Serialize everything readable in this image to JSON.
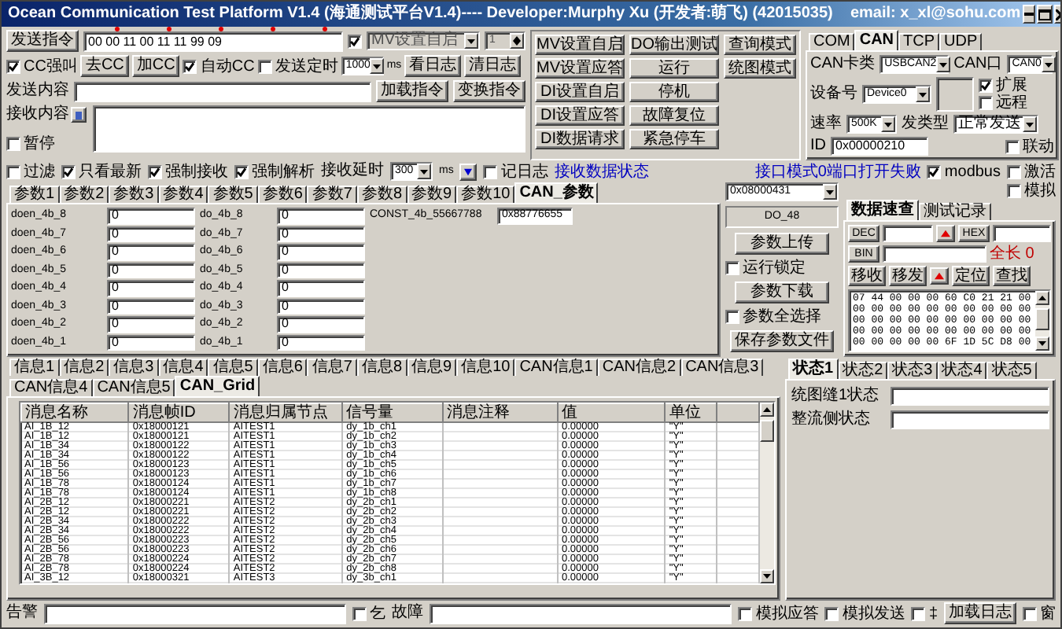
{
  "window": {
    "title": "Ocean Communication Test Platform V1.4 (海通测试平台V1.4)---- Developer:Murphy Xu (开发者:萌飞) (42015035)    email: x_xl@sohu.com"
  },
  "send_row": {
    "button": "发送指令",
    "value": "00 00 11 00 11 11 99 09",
    "enable_checked": true,
    "mode": {
      "value": "MV设置自启",
      "disabled": true
    },
    "spinner": {
      "value": "1",
      "disabled": true
    }
  },
  "command_row": [
    {
      "kind": "checkbox",
      "label": "CC强叫",
      "checked": true
    },
    {
      "kind": "button",
      "label": "去CC"
    },
    {
      "kind": "button",
      "label": "加CC"
    },
    {
      "kind": "checkbox",
      "label": "自动CC",
      "checked": true
    },
    {
      "kind": "checkbox",
      "label": "发送定时",
      "checked": false
    },
    {
      "kind": "combo",
      "value": "1000"
    },
    {
      "kind": "unit",
      "label": "ms"
    },
    {
      "kind": "button",
      "label": "看日志"
    },
    {
      "kind": "button",
      "label": "清日志"
    }
  ],
  "content_row": {
    "label": "发送内容",
    "buttons": [
      "加载指令",
      "变换指令"
    ]
  },
  "receive": {
    "label": "接收内容",
    "pause": {
      "label": "暂停",
      "checked": false
    }
  },
  "action_buttons": [
    [
      "MV设置自启",
      "MV设置应答",
      "DI设置自启",
      "DI设置应答",
      "DI数据请求"
    ],
    [
      "DO输出测试",
      "运行",
      "停机",
      "故障复位",
      "紧急停车"
    ],
    [
      "查询模式",
      "统图模式"
    ]
  ],
  "can_panel": {
    "tabs": [
      {
        "label": "COM",
        "selected": false
      },
      {
        "label": "CAN",
        "selected": true
      },
      {
        "label": "TCP",
        "selected": false
      },
      {
        "label": "UDP",
        "selected": false
      }
    ],
    "card_type": {
      "label": "CAN卡类",
      "value": "USBCAN2"
    },
    "port": {
      "label": "CAN口",
      "value": "CAN0"
    },
    "device": {
      "label": "设备号",
      "value": "Device0"
    },
    "extended": {
      "label": "扩展",
      "checked": true
    },
    "remote": {
      "label": "远程",
      "checked": false
    },
    "rate": {
      "label": "速率",
      "value": "500K"
    },
    "send_type": {
      "label": "发类型",
      "value": "正常发送"
    },
    "id": {
      "label": "ID",
      "value": "0x00000210"
    },
    "linkage": {
      "label": "联动",
      "checked": false
    }
  },
  "options": [
    {
      "kind": "checkbox",
      "label": "过滤",
      "checked": false
    },
    {
      "kind": "checkbox",
      "label": "只看最新",
      "checked": true
    },
    {
      "kind": "checkbox",
      "label": "强制接收",
      "checked": true
    },
    {
      "kind": "checkbox",
      "label": "强制解析",
      "checked": true
    },
    {
      "kind": "label",
      "label": "接收延时"
    },
    {
      "kind": "combo",
      "value": "300"
    },
    {
      "kind": "unit",
      "label": "ms"
    },
    {
      "kind": "icon_button"
    },
    {
      "kind": "checkbox",
      "label": "记日志",
      "checked": false
    },
    {
      "kind": "link",
      "label": "接收数据状态"
    }
  ],
  "status_message": "接口模式0端口打开失败",
  "flags": [
    {
      "label": "modbus",
      "checked": true
    },
    {
      "label": "激活",
      "checked": false
    }
  ],
  "simulate": {
    "label": "模拟",
    "checked": false
  },
  "params": {
    "tabs": [
      {
        "label": "参数1",
        "selected": false
      },
      {
        "label": "参数2",
        "selected": false
      },
      {
        "label": "参数3",
        "selected": false
      },
      {
        "label": "参数4",
        "selected": false
      },
      {
        "label": "参数5",
        "selected": false
      },
      {
        "label": "参数6",
        "selected": false
      },
      {
        "label": "参数7",
        "selected": false
      },
      {
        "label": "参数8",
        "selected": false
      },
      {
        "label": "参数9",
        "selected": false
      },
      {
        "label": "参数10",
        "selected": false
      },
      {
        "label": "CAN_参数",
        "selected": true
      }
    ],
    "left": [
      {
        "label": "doen_4b_8",
        "value": "0"
      },
      {
        "label": "doen_4b_7",
        "value": "0"
      },
      {
        "label": "doen_4b_6",
        "value": "0"
      },
      {
        "label": "doen_4b_5",
        "value": "0"
      },
      {
        "label": "doen_4b_4",
        "value": "0"
      },
      {
        "label": "doen_4b_3",
        "value": "0"
      },
      {
        "label": "doen_4b_2",
        "value": "0"
      },
      {
        "label": "doen_4b_1",
        "value": "0"
      }
    ],
    "right": [
      {
        "label": "do_4b_8",
        "value": "0"
      },
      {
        "label": "do_4b_7",
        "value": "0"
      },
      {
        "label": "do_4b_6",
        "value": "0"
      },
      {
        "label": "do_4b_5",
        "value": "0"
      },
      {
        "label": "do_4b_4",
        "value": "0"
      },
      {
        "label": "do_4b_3",
        "value": "0"
      },
      {
        "label": "do_4b_2",
        "value": "0"
      },
      {
        "label": "do_4b_1",
        "value": "0"
      }
    ],
    "const": {
      "label": "CONST_4b_55667788",
      "value": "0x88776655"
    }
  },
  "side": {
    "combo": "0x08000431",
    "caption": "DO_48",
    "upload": "参数上传",
    "lock": {
      "label": "运行锁定",
      "checked": false
    },
    "download": "参数下载",
    "select_all": {
      "label": "参数全选择",
      "checked": false
    },
    "save": "保存参数文件"
  },
  "data_panel": {
    "tabs": [
      {
        "label": "数据速查",
        "selected": true
      },
      {
        "label": "测试记录",
        "selected": false
      }
    ],
    "dec": "DEC",
    "hex": "HEX",
    "bin": "BIN",
    "length": "全长 0",
    "tools": [
      {
        "kind": "button",
        "label": "移收"
      },
      {
        "kind": "button",
        "label": "移发"
      },
      {
        "kind": "arrow"
      },
      {
        "kind": "button",
        "label": "定位"
      },
      {
        "kind": "button",
        "label": "查找"
      }
    ],
    "hex_lines": [
      "07 44 00 00 00 60 C0 21 21 00",
      "00 00 00 00 00 00 00 00 00 00",
      "00 00 00 00 00 00 00 00 00 00",
      "00 00 00 00 00 00 00 00 00 00",
      "00 00 00 00 00 6F 1D 5C D8 00"
    ]
  },
  "messages": {
    "tabs": [
      {
        "label": "信息1",
        "selected": false
      },
      {
        "label": "信息2",
        "selected": false
      },
      {
        "label": "信息3",
        "selected": false
      },
      {
        "label": "信息4",
        "selected": false
      },
      {
        "label": "信息5",
        "selected": false
      },
      {
        "label": "信息6",
        "selected": false
      },
      {
        "label": "信息7",
        "selected": false
      },
      {
        "label": "信息8",
        "selected": false
      },
      {
        "label": "信息9",
        "selected": false
      },
      {
        "label": "信息10",
        "selected": false
      },
      {
        "label": "CAN信息1",
        "selected": false
      },
      {
        "label": "CAN信息2",
        "selected": false
      },
      {
        "label": "CAN信息3",
        "selected": false
      },
      {
        "label": "CAN信息4",
        "selected": false
      },
      {
        "label": "CAN信息5",
        "selected": false
      },
      {
        "label": "CAN_Grid",
        "selected": true
      }
    ],
    "columns": [
      "消息名称",
      "消息帧ID",
      "消息归属节点",
      "信号量",
      "消息注释",
      "值",
      "单位"
    ],
    "rows": [
      {
        "name": "AI_1B_12",
        "frame_id": "0x18000121",
        "node": "AITEST1",
        "signal": "dy_1b_ch1",
        "value": "0.00000",
        "unit": "\"Y\""
      },
      {
        "name": "AI_1B_12",
        "frame_id": "0x18000121",
        "node": "AITEST1",
        "signal": "dy_1b_ch2",
        "value": "0.00000",
        "unit": "\"Y\""
      },
      {
        "name": "AI_1B_34",
        "frame_id": "0x18000122",
        "node": "AITEST1",
        "signal": "dy_1b_ch3",
        "value": "0.00000",
        "unit": "\"Y\""
      },
      {
        "name": "AI_1B_34",
        "frame_id": "0x18000122",
        "node": "AITEST1",
        "signal": "dy_1b_ch4",
        "value": "0.00000",
        "unit": "\"Y\""
      },
      {
        "name": "AI_1B_56",
        "frame_id": "0x18000123",
        "node": "AITEST1",
        "signal": "dy_1b_ch5",
        "value": "0.00000",
        "unit": "\"Y\""
      },
      {
        "name": "AI_1B_56",
        "frame_id": "0x18000123",
        "node": "AITEST1",
        "signal": "dy_1b_ch6",
        "value": "0.00000",
        "unit": "\"Y\""
      },
      {
        "name": "AI_1B_78",
        "frame_id": "0x18000124",
        "node": "AITEST1",
        "signal": "dy_1b_ch7",
        "value": "0.00000",
        "unit": "\"Y\""
      },
      {
        "name": "AI_1B_78",
        "frame_id": "0x18000124",
        "node": "AITEST1",
        "signal": "dy_1b_ch8",
        "value": "0.00000",
        "unit": "\"Y\""
      },
      {
        "name": "AI_2B_12",
        "frame_id": "0x18000221",
        "node": "AITEST2",
        "signal": "dy_2b_ch1",
        "value": "0.00000",
        "unit": "\"Y\""
      },
      {
        "name": "AI_2B_12",
        "frame_id": "0x18000221",
        "node": "AITEST2",
        "signal": "dy_2b_ch2",
        "value": "0.00000",
        "unit": "\"Y\""
      },
      {
        "name": "AI_2B_34",
        "frame_id": "0x18000222",
        "node": "AITEST2",
        "signal": "dy_2b_ch3",
        "value": "0.00000",
        "unit": "\"Y\""
      },
      {
        "name": "AI_2B_34",
        "frame_id": "0x18000222",
        "node": "AITEST2",
        "signal": "dy_2b_ch4",
        "value": "0.00000",
        "unit": "\"Y\""
      },
      {
        "name": "AI_2B_56",
        "frame_id": "0x18000223",
        "node": "AITEST2",
        "signal": "dy_2b_ch5",
        "value": "0.00000",
        "unit": "\"Y\""
      },
      {
        "name": "AI_2B_56",
        "frame_id": "0x18000223",
        "node": "AITEST2",
        "signal": "dy_2b_ch6",
        "value": "0.00000",
        "unit": "\"Y\""
      },
      {
        "name": "AI_2B_78",
        "frame_id": "0x18000224",
        "node": "AITEST2",
        "signal": "dy_2b_ch7",
        "value": "0.00000",
        "unit": "\"Y\""
      },
      {
        "name": "AI_2B_78",
        "frame_id": "0x18000224",
        "node": "AITEST2",
        "signal": "dy_2b_ch8",
        "value": "0.00000",
        "unit": "\"Y\""
      },
      {
        "name": "AI_3B_12",
        "frame_id": "0x18000321",
        "node": "AITEST3",
        "signal": "dy_3b_ch1",
        "value": "0.00000",
        "unit": "\"Y\""
      }
    ]
  },
  "status_panel": {
    "tabs": [
      {
        "label": "状态1",
        "selected": true
      },
      {
        "label": "状态2",
        "selected": false
      },
      {
        "label": "状态3",
        "selected": false
      },
      {
        "label": "状态4",
        "selected": false
      },
      {
        "label": "状态5",
        "selected": false
      }
    ],
    "fields": [
      {
        "label": "统图缝1状态"
      },
      {
        "label": "整流侧状态"
      }
    ]
  },
  "footer": {
    "alarm": "告警",
    "clear": {
      "label": "乞",
      "checked": false
    },
    "fault": "故障",
    "sim_reply": {
      "label": "模拟应答",
      "checked": false
    },
    "sim_send": {
      "label": "模拟发送",
      "checked": false
    },
    "mark": {
      "label": "‡",
      "checked": false
    },
    "load_log": "加载日志",
    "pin": {
      "label": "窗",
      "checked": false
    }
  }
}
